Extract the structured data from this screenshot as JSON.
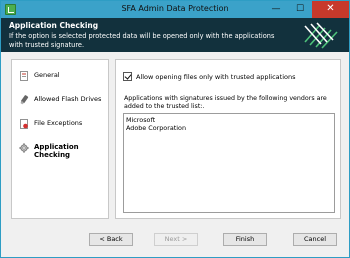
{
  "window": {
    "title": "SFA Admin Data Protection",
    "minimize_glyph": "—",
    "maximize_glyph": "☐",
    "close_glyph": "✕"
  },
  "banner": {
    "title": "Application Checking",
    "description": "If the option is selected protected data will be opened only with the applications with trusted signature."
  },
  "sidebar": {
    "items": [
      {
        "label": "General",
        "icon": "general-page-icon"
      },
      {
        "label": "Allowed Flash Drives",
        "icon": "flash-drive-icon"
      },
      {
        "label": "File Exceptions",
        "icon": "file-exceptions-icon"
      },
      {
        "label": "Application Checking",
        "icon": "gear-icon",
        "active": true
      }
    ]
  },
  "content": {
    "checkbox_label": "Allow opening files only with trusted applications",
    "checkbox_checked": true,
    "description": "Applications with signatures issued by the following vendors are added to the trusted list:.",
    "vendors": [
      "Microsoft",
      "Adobe Corporation"
    ]
  },
  "footer": {
    "back_label": "< Back",
    "next_label": "Next >",
    "finish_label": "Finish",
    "cancel_label": "Cancel"
  },
  "colors": {
    "titlebar": "#3ba2c9",
    "banner_bg": "#12313d",
    "close_button": "#c7392b",
    "logo_accent": "#4ec27a"
  }
}
